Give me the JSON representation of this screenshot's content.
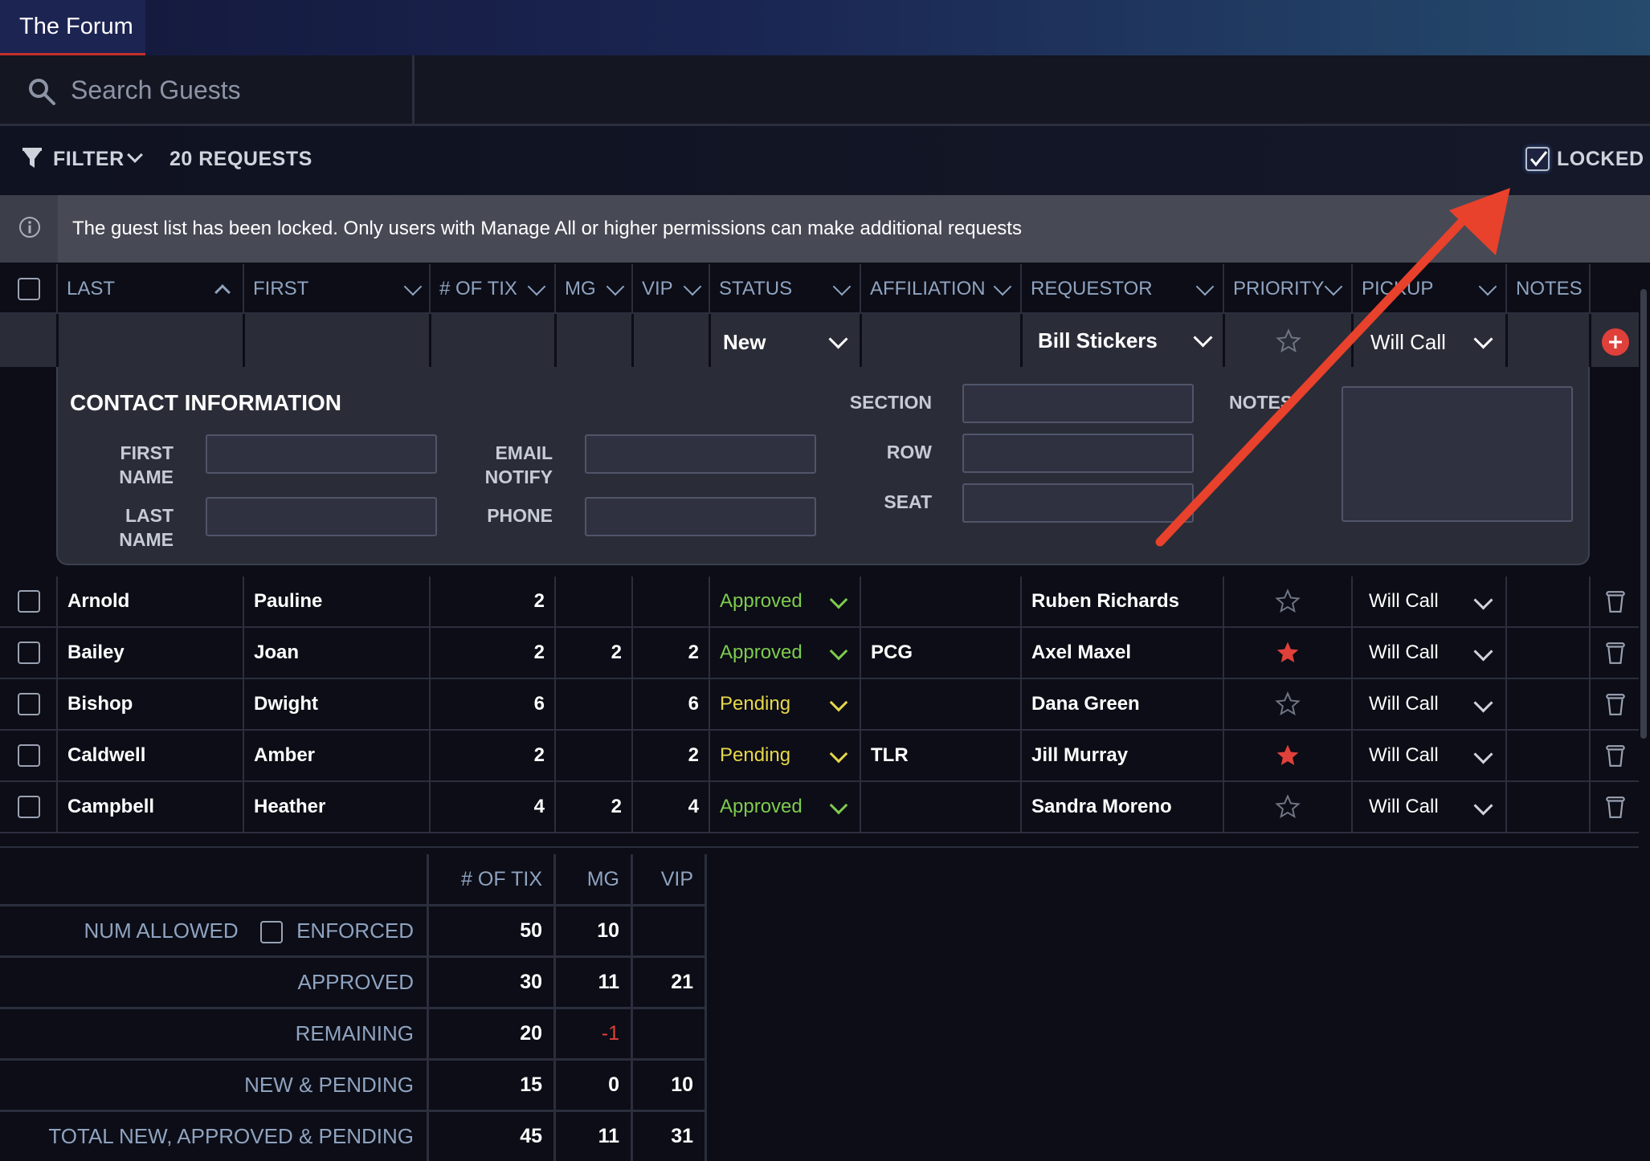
{
  "app": {
    "tab_title": "The Forum"
  },
  "search": {
    "placeholder": "Search Guests"
  },
  "toolbar": {
    "filter_label": "FILTER",
    "request_count": "20 REQUESTS",
    "locked_label": "LOCKED",
    "locked_checked": true
  },
  "info_banner": {
    "text": "The guest list has been locked. Only users with Manage All or higher permissions can make additional requests"
  },
  "columns": [
    "LAST",
    "FIRST",
    "# OF TIX",
    "MG",
    "VIP",
    "STATUS",
    "AFFILIATION",
    "REQUESTOR",
    "PRIORITY",
    "PICKUP",
    "NOTES"
  ],
  "new_row": {
    "status": "New",
    "requestor": "Bill Stickers",
    "pickup": "Will Call"
  },
  "contact": {
    "title": "CONTACT INFORMATION",
    "first_name_label": "FIRST NAME",
    "last_name_label": "LAST NAME",
    "email_label": "EMAIL NOTIFY",
    "phone_label": "PHONE",
    "section_label": "SECTION",
    "row_label": "ROW",
    "seat_label": "SEAT",
    "notes_label": "NOTES"
  },
  "rows": [
    {
      "last": "Arnold",
      "first": "Pauline",
      "tix": "2",
      "mg": "",
      "vip": "",
      "status": "Approved",
      "affiliation": "",
      "requestor": "Ruben Richards",
      "priority": false,
      "pickup": "Will Call"
    },
    {
      "last": "Bailey",
      "first": "Joan",
      "tix": "2",
      "mg": "2",
      "vip": "2",
      "status": "Approved",
      "affiliation": "PCG",
      "requestor": "Axel Maxel",
      "priority": true,
      "pickup": "Will Call"
    },
    {
      "last": "Bishop",
      "first": "Dwight",
      "tix": "6",
      "mg": "",
      "vip": "6",
      "status": "Pending",
      "affiliation": "",
      "requestor": "Dana Green",
      "priority": false,
      "pickup": "Will Call"
    },
    {
      "last": "Caldwell",
      "first": "Amber",
      "tix": "2",
      "mg": "",
      "vip": "2",
      "status": "Pending",
      "affiliation": "TLR",
      "requestor": "Jill Murray",
      "priority": true,
      "pickup": "Will Call"
    },
    {
      "last": "Campbell",
      "first": "Heather",
      "tix": "4",
      "mg": "2",
      "vip": "4",
      "status": "Approved",
      "affiliation": "",
      "requestor": "Sandra Moreno",
      "priority": false,
      "pickup": "Will Call"
    }
  ],
  "summary": {
    "headers": {
      "tix": "# OF TIX",
      "mg": "MG",
      "vip": "VIP"
    },
    "enforced_label": "ENFORCED",
    "rows": [
      {
        "label": "NUM ALLOWED",
        "tix": "50",
        "mg": "10",
        "vip": ""
      },
      {
        "label": "APPROVED",
        "tix": "30",
        "mg": "11",
        "vip": "21"
      },
      {
        "label": "REMAINING",
        "tix": "20",
        "mg": "-1",
        "vip": ""
      },
      {
        "label": "NEW & PENDING",
        "tix": "15",
        "mg": "0",
        "vip": "10"
      },
      {
        "label": "TOTAL NEW, APPROVED & PENDING",
        "tix": "45",
        "mg": "11",
        "vip": "31"
      }
    ]
  },
  "colors": {
    "accent_red": "#e0403a",
    "approved": "#7ecb4f",
    "pending": "#e7d74a",
    "header_text": "#8fa3c0"
  }
}
